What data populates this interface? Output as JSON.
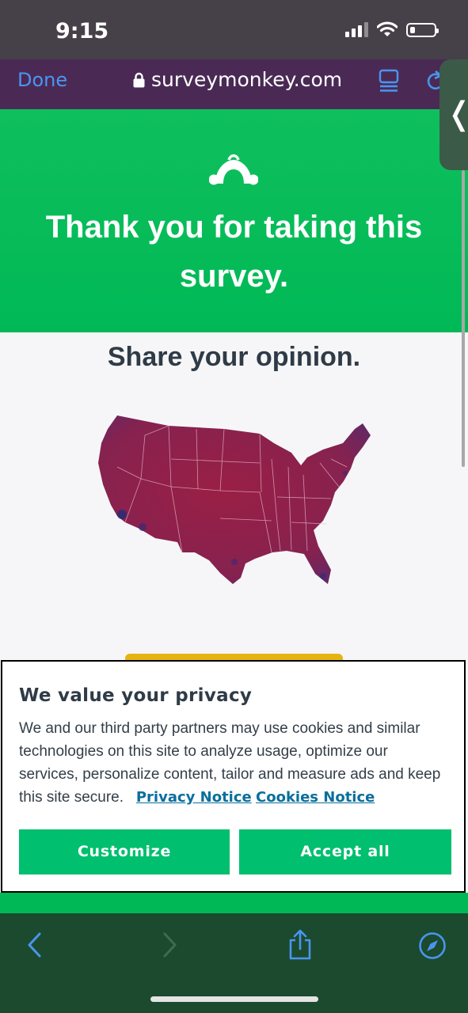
{
  "status_bar": {
    "time": "9:15"
  },
  "browser": {
    "done_label": "Done",
    "url": "surveymonkey.com"
  },
  "hero": {
    "title": "Thank you for taking this survey."
  },
  "content": {
    "share_heading": "Share your opinion."
  },
  "cookie_banner": {
    "title": "We value your privacy",
    "body": "We and our third party partners may use cookies and similar technologies on this site to analyze usage, optimize our services, personalize content, tailor and measure ads and keep this site secure.",
    "privacy_link": "Privacy Notice",
    "cookies_link": "Cookies Notice",
    "customize_label": "Customize",
    "accept_label": "Accept all"
  },
  "colors": {
    "hero_green": "#00b956",
    "button_green": "#00bf6f",
    "browser_bar": "#4a2a55",
    "link_blue": "#0a6f9c",
    "toolbar": "#1c4a2e",
    "map_fill": "#8e1f4a"
  },
  "icons": {
    "toolbar": [
      "back-icon",
      "forward-icon",
      "share-icon",
      "compass-icon"
    ],
    "browser": [
      "lock-icon",
      "reader-mode-icon",
      "reload-icon"
    ]
  }
}
